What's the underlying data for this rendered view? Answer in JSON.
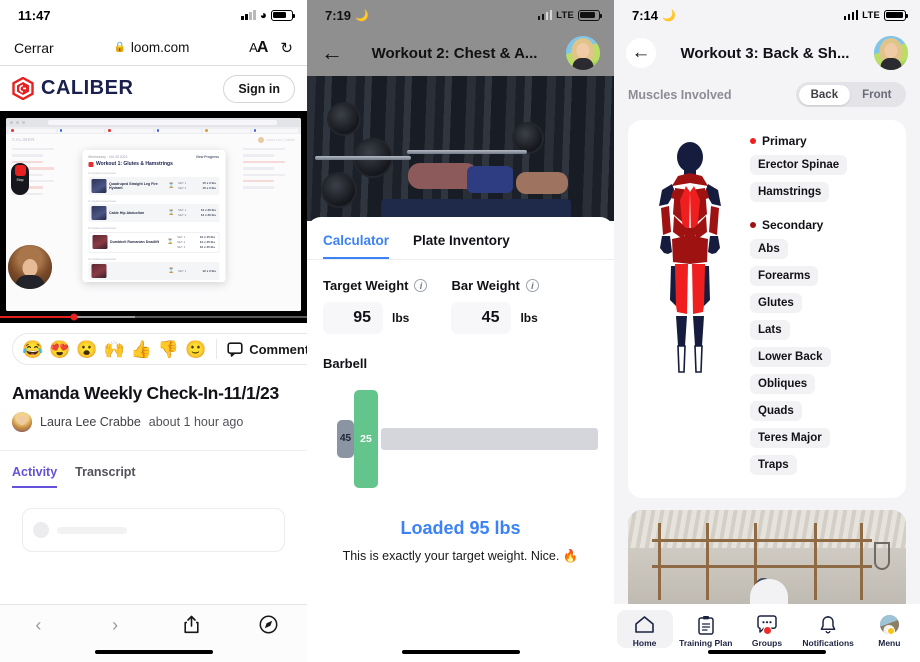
{
  "panel1": {
    "status": {
      "time": "11:47",
      "wifi_icon": "wifi-icon",
      "battery_icon": "battery-icon"
    },
    "safari": {
      "close_label": "Cerrar",
      "url": "loom.com",
      "lock_icon": "lock-icon",
      "text_size_label": "AA",
      "reload_icon": "reload-icon"
    },
    "site": {
      "brand": "CALIBER",
      "logo_icon": "caliber-hex-logo-icon",
      "signin_label": "Sign in"
    },
    "video": {
      "progress_percent": 24,
      "buffered_percent": 44,
      "recorder_label": "Stop",
      "embedded_app": {
        "brand": "CALIBER",
        "user": "Laura Lee Crabbe",
        "modal_date": "Wednesday · Oct 25 2023",
        "modal_progress": "View Progress",
        "modal_title": "Workout 1: Glutes & Hamstrings",
        "exercises": [
          {
            "group_label": "Completed exercises",
            "name": "Quadruped Straight Leg Fire Hydrant",
            "sets": [
              {
                "set": "SET 1",
                "val": "15 x 0 lbs"
              },
              {
                "set": "SET 2",
                "val": "15 x 0 lbs"
              }
            ]
          },
          {
            "group_label": "Completed exercises",
            "name": "Cable Hip Abduction",
            "sets": [
              {
                "set": "SET 1",
                "val": "12 x 20 lbs"
              },
              {
                "set": "SET 2",
                "val": "12 x 20 lbs"
              }
            ]
          },
          {
            "group_label": "Completed exercises",
            "name": "Dumbbell Romanian Deadlift",
            "sets": [
              {
                "set": "SET 1",
                "val": "10 x 45 lbs"
              },
              {
                "set": "SET 2",
                "val": "10 x 45 lbs"
              },
              {
                "set": "SET 3",
                "val": "10 x 45 lbs"
              }
            ]
          },
          {
            "group_label": "Completed exercises",
            "name": "",
            "sets": [
              {
                "set": "SET 1",
                "val": "12 x 0 lbs"
              }
            ]
          }
        ]
      }
    },
    "reactions": {
      "emojis": [
        "😂",
        "😍",
        "😮",
        "🙌",
        "👍",
        "👎"
      ],
      "add_reaction_icon": "add-reaction-icon",
      "comment_icon": "comment-bubble-icon",
      "comment_label": "Comment"
    },
    "post": {
      "title": "Amanda Weekly Check-In-11/1/23",
      "author": "Laura Lee Crabbe",
      "timestamp": "about 1 hour ago",
      "avatar_icon": "author-avatar"
    },
    "tabs": [
      {
        "label": "Activity",
        "active": true
      },
      {
        "label": "Transcript",
        "active": false
      }
    ],
    "toolbar": {
      "back_icon": "chevron-left-icon",
      "forward_icon": "chevron-right-icon",
      "share_icon": "share-icon",
      "tabs_icon": "safari-compass-icon"
    }
  },
  "panel2": {
    "status": {
      "time": "7:19",
      "moon_icon": "crescent-moon-icon",
      "carrier": "LTE",
      "battery_icon": "battery-icon"
    },
    "nav": {
      "back_icon": "arrow-left-icon",
      "title": "Workout 2: Chest & A...",
      "avatar_icon": "user-avatar"
    },
    "hero_image": "bench-press-photo",
    "tabs": [
      {
        "label": "Calculator",
        "active": true
      },
      {
        "label": "Plate Inventory",
        "active": false
      }
    ],
    "fields": [
      {
        "label": "Target Weight",
        "info_icon": "info-icon",
        "value": "95",
        "unit": "lbs"
      },
      {
        "label": "Bar Weight",
        "info_icon": "info-icon",
        "value": "45",
        "unit": "lbs"
      }
    ],
    "barbell": {
      "section_label": "Barbell",
      "collar_value": "45",
      "plate_value": "25",
      "collar_color": "#8b94a3",
      "plate_color": "#63c48c"
    },
    "result": {
      "headline": "Loaded 95 lbs",
      "headline_color": "#3b82f6",
      "subtext": "This is exactly your target weight. Nice. 🔥"
    }
  },
  "panel3": {
    "status": {
      "time": "7:14",
      "moon_icon": "crescent-moon-icon",
      "carrier": "LTE",
      "battery_icon": "battery-icon"
    },
    "nav": {
      "back_icon": "arrow-left-icon",
      "title": "Workout 3: Back & Sh...",
      "avatar_icon": "user-avatar"
    },
    "section": {
      "title": "Muscles Involved",
      "toggle": [
        {
          "label": "Back",
          "active": true
        },
        {
          "label": "Front",
          "active": false
        }
      ]
    },
    "figure": {
      "icon": "anatomy-back-view-figure",
      "view": "Back"
    },
    "muscles": {
      "primary": {
        "label": "Primary",
        "color": "#f01f1f",
        "items": [
          "Erector Spinae",
          "Hamstrings"
        ]
      },
      "secondary": {
        "label": "Secondary",
        "color": "#9e1212",
        "items": [
          "Abs",
          "Forearms",
          "Glutes",
          "Lats",
          "Lower Back",
          "Obliques",
          "Quads",
          "Teres Major",
          "Traps"
        ]
      }
    },
    "gym_card_image": "gym-rig-photo",
    "tabbar": [
      {
        "label": "Home",
        "icon": "home-icon",
        "active": true,
        "badge": ""
      },
      {
        "label": "Training Plan",
        "icon": "clipboard-icon",
        "active": false,
        "badge": ""
      },
      {
        "label": "Groups",
        "icon": "chat-bubble-icon",
        "active": false,
        "badge": "red-dot"
      },
      {
        "label": "Notifications",
        "icon": "bell-icon",
        "active": false,
        "badge": ""
      },
      {
        "label": "Menu",
        "icon": "avatar-icon",
        "active": false,
        "badge": "yellow-dot"
      }
    ]
  }
}
